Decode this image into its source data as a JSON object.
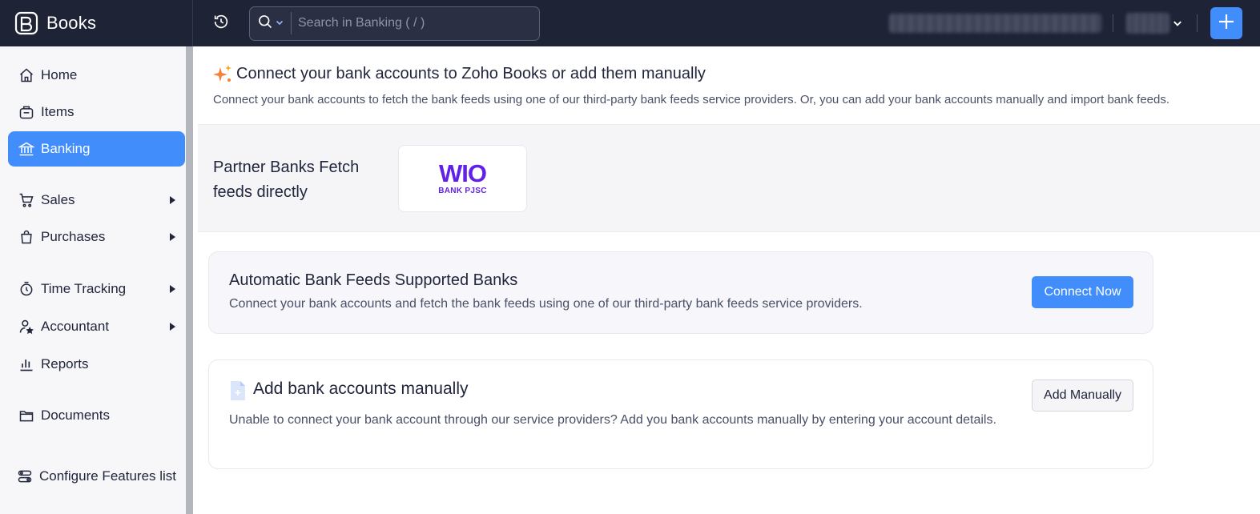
{
  "app": {
    "name": "Books"
  },
  "search": {
    "placeholder": "Search in Banking ( / )"
  },
  "sidebar": {
    "items": [
      {
        "label": "Home",
        "icon": "home-icon"
      },
      {
        "label": "Items",
        "icon": "items-icon"
      },
      {
        "label": "Banking",
        "icon": "bank-icon",
        "active": true
      },
      {
        "label": "Sales",
        "icon": "cart-icon",
        "expandable": true
      },
      {
        "label": "Purchases",
        "icon": "bag-icon",
        "expandable": true
      },
      {
        "label": "Time Tracking",
        "icon": "stopwatch-icon",
        "expandable": true
      },
      {
        "label": "Accountant",
        "icon": "accountant-icon",
        "expandable": true
      },
      {
        "label": "Reports",
        "icon": "reports-icon"
      },
      {
        "label": "Documents",
        "icon": "folder-icon"
      }
    ],
    "configure_label": "Configure Features list"
  },
  "main": {
    "hero": {
      "title": "Connect your bank accounts to Zoho Books or add them manually",
      "subtitle": "Connect your bank accounts to fetch the bank feeds using one of our third-party bank feeds service providers. Or, you can add your bank accounts manually and import bank feeds."
    },
    "partner": {
      "text": "Partner Banks Fetch feeds directly",
      "bank_logo_text": "WIO",
      "bank_logo_sub": "BANK PJSC"
    },
    "auto_feeds": {
      "title": "Automatic Bank Feeds Supported Banks",
      "subtitle": "Connect your bank accounts and fetch the bank feeds using one of our third-party bank feeds service providers.",
      "button": "Connect Now"
    },
    "manual": {
      "title": "Add bank accounts manually",
      "subtitle": "Unable to connect your bank account through our service providers? Add you bank accounts manually by entering your account details.",
      "button": "Add Manually"
    }
  },
  "colors": {
    "topbar": "#1f2336",
    "accent": "#408dfb",
    "sidebar_bg": "#f7f7fa",
    "wio_purple": "#6121e6"
  }
}
